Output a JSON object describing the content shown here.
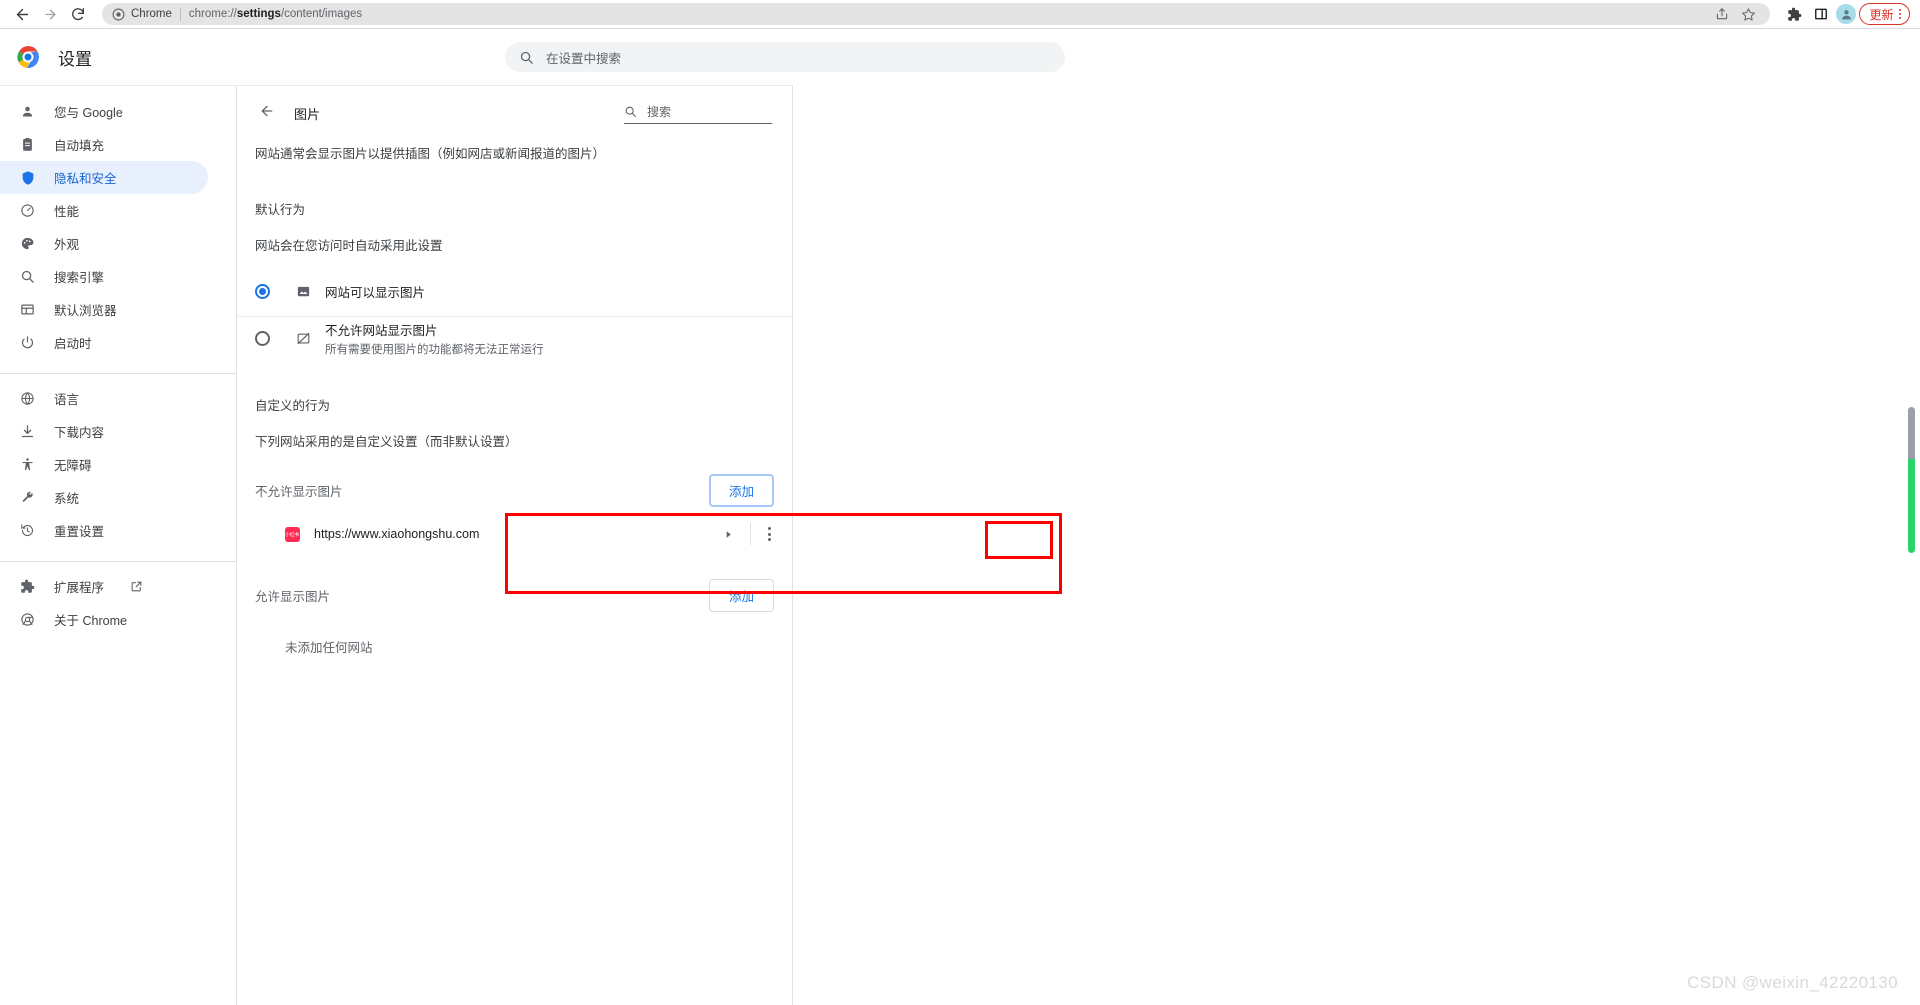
{
  "browser": {
    "back_icon": "back-arrow-icon",
    "forward_icon": "forward-arrow-icon",
    "reload_icon": "reload-icon",
    "omnibox": {
      "chrome_icon": "chrome-shield-icon",
      "label": "Chrome",
      "url_prefix": "chrome://",
      "url_bold": "settings",
      "url_suffix": "/content/images",
      "share_icon": "share-icon",
      "bookmark_icon": "star-bookmark-icon"
    },
    "toolbar": {
      "extensions_icon": "puzzle-extensions-icon",
      "side_panel_icon": "side-panel-icon",
      "avatar_icon": "profile-avatar-icon",
      "update_label": "更新",
      "menu_icon": "three-dot-menu-icon"
    }
  },
  "settings": {
    "brand_title": "设置",
    "brand_icon": "chrome-logo-icon",
    "search": {
      "icon": "search-icon",
      "placeholder": "在设置中搜索",
      "value": ""
    }
  },
  "sidebar": {
    "groups": [
      {
        "items": [
          {
            "label": "您与 Google",
            "icon": "person-icon",
            "active": false
          },
          {
            "label": "自动填充",
            "icon": "clipboard-autofill-icon",
            "active": false
          },
          {
            "label": "隐私和安全",
            "icon": "shield-icon",
            "active": true
          },
          {
            "label": "性能",
            "icon": "speedometer-performance-icon",
            "active": false
          },
          {
            "label": "外观",
            "icon": "palette-appearance-icon",
            "active": false
          },
          {
            "label": "搜索引擎",
            "icon": "search-icon",
            "active": false
          },
          {
            "label": "默认浏览器",
            "icon": "browser-window-icon",
            "active": false
          },
          {
            "label": "启动时",
            "icon": "power-icon",
            "active": false
          }
        ]
      },
      {
        "items": [
          {
            "label": "语言",
            "icon": "globe-language-icon",
            "active": false
          },
          {
            "label": "下载内容",
            "icon": "download-icon",
            "active": false
          },
          {
            "label": "无障碍",
            "icon": "accessibility-icon",
            "active": false
          },
          {
            "label": "系统",
            "icon": "wrench-system-icon",
            "active": false
          },
          {
            "label": "重置设置",
            "icon": "history-reset-icon",
            "active": false
          }
        ]
      },
      {
        "items": [
          {
            "label": "扩展程序",
            "icon": "puzzle-extensions-icon",
            "active": false,
            "external": true,
            "external_icon": "external-link-icon"
          },
          {
            "label": "关于 Chrome",
            "icon": "chrome-logo-icon",
            "active": false
          }
        ]
      }
    ]
  },
  "page": {
    "back_icon": "back-arrow-icon",
    "title": "图片",
    "search": {
      "icon": "search-icon",
      "placeholder": "搜索",
      "value": ""
    },
    "description": "网站通常会显示图片以提供插图（例如网店或新闻报道的图片）",
    "default_behavior": {
      "title": "默认行为",
      "subtitle": "网站会在您访问时自动采用此设置",
      "options": [
        {
          "label": "网站可以显示图片",
          "sub": "",
          "icon": "image-icon",
          "selected": true
        },
        {
          "label": "不允许网站显示图片",
          "sub": "所有需要使用图片的功能都将无法正常运行",
          "icon": "image-blocked-icon",
          "selected": false
        }
      ]
    },
    "custom_behavior": {
      "title": "自定义的行为",
      "subtitle": "下列网站采用的是自定义设置（而非默认设置）",
      "sections": [
        {
          "title": "不允许显示图片",
          "add_label": "添加",
          "add_focused": true,
          "highlighted": true,
          "empty_text": "",
          "sites": [
            {
              "url": "https://www.xiaohongshu.com",
              "favicon_text": "小红书",
              "favicon_color": "#fe2c55",
              "expand_icon": "chevron-right-icon",
              "menu_icon": "three-dot-menu-icon"
            }
          ]
        },
        {
          "title": "允许显示图片",
          "add_label": "添加",
          "add_focused": false,
          "highlighted": false,
          "empty_text": "未添加任何网站",
          "sites": []
        }
      ]
    }
  },
  "annotations": {
    "color": "#ff0000",
    "boxes": [
      {
        "name": "blocked-images-section-highlight"
      },
      {
        "name": "add-button-highlight"
      }
    ]
  },
  "scrollbar": {
    "thumb_gray_color": "#9aa0a6",
    "thumb_green_color": "#2ad46a"
  },
  "watermark": {
    "text": "CSDN @weixin_42220130"
  }
}
